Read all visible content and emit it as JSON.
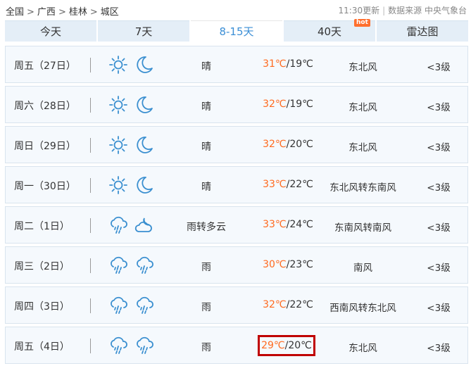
{
  "breadcrumb": [
    "全国",
    "广西",
    "桂林",
    "城区"
  ],
  "breadcrumb_sep": ">",
  "update_time": "11:30更新",
  "source": "数据来源 中央气象台",
  "tabs": [
    {
      "label": "今天",
      "active": false
    },
    {
      "label": "7天",
      "active": false
    },
    {
      "label": "8-15天",
      "active": true
    },
    {
      "label": "40天",
      "active": false,
      "badge": "hot"
    },
    {
      "label": "雷达图",
      "active": false
    }
  ],
  "forecast": [
    {
      "day": "周五（27日）",
      "icon_day": "sun-icon",
      "icon_night": "moon-icon",
      "weather": "晴",
      "high": "31℃",
      "low": "/19℃",
      "wind": "东北风",
      "level": "<3级",
      "highlighted": false
    },
    {
      "day": "周六（28日）",
      "icon_day": "sun-icon",
      "icon_night": "moon-icon",
      "weather": "晴",
      "high": "32℃",
      "low": "/19℃",
      "wind": "东北风",
      "level": "<3级",
      "highlighted": false
    },
    {
      "day": "周日（29日）",
      "icon_day": "sun-icon",
      "icon_night": "moon-icon",
      "weather": "晴",
      "high": "32℃",
      "low": "/20℃",
      "wind": "东北风",
      "level": "<3级",
      "highlighted": false
    },
    {
      "day": "周一（30日）",
      "icon_day": "sun-icon",
      "icon_night": "moon-icon",
      "weather": "晴",
      "high": "33℃",
      "low": "/22℃",
      "wind": "东北风转东南风",
      "level": "<3级",
      "highlighted": false
    },
    {
      "day": "周二（1日）",
      "icon_day": "rain-icon",
      "icon_night": "cloudy-night-icon",
      "weather": "雨转多云",
      "high": "33℃",
      "low": "/24℃",
      "wind": "东南风转南风",
      "level": "<3级",
      "highlighted": false
    },
    {
      "day": "周三（2日）",
      "icon_day": "rain-icon",
      "icon_night": "rain-icon",
      "weather": "雨",
      "high": "30℃",
      "low": "/23℃",
      "wind": "南风",
      "level": "<3级",
      "highlighted": false
    },
    {
      "day": "周四（3日）",
      "icon_day": "rain-icon",
      "icon_night": "rain-icon",
      "weather": "雨",
      "high": "32℃",
      "low": "/22℃",
      "wind": "西南风转东北风",
      "level": "<3级",
      "highlighted": false
    },
    {
      "day": "周五（4日）",
      "icon_day": "rain-icon",
      "icon_night": "rain-icon",
      "weather": "雨",
      "high": "29℃",
      "low": "/20℃",
      "wind": "东北风",
      "level": "<3级",
      "highlighted": true
    }
  ],
  "colors": {
    "tab_bg": "#e4eef7",
    "active_tab_text": "#3c8fd6",
    "high_temp": "#ff6a1f",
    "highlight_box": "#c00000",
    "icon_stroke": "#3a8fd0"
  }
}
